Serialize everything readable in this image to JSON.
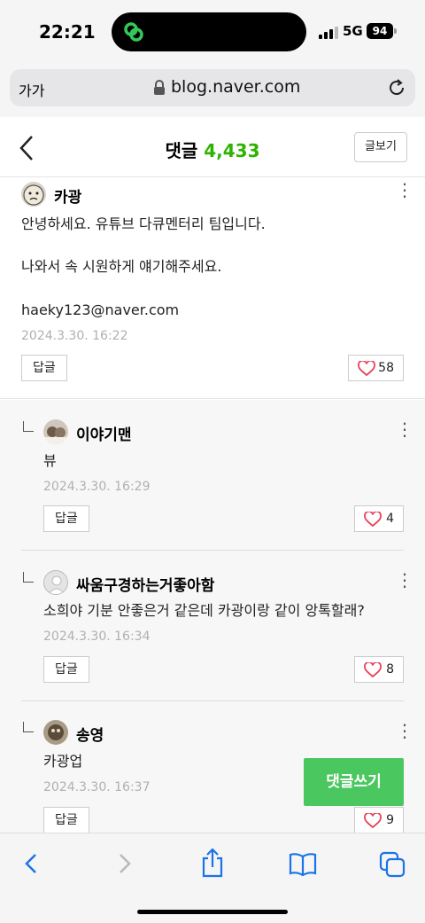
{
  "status_bar": {
    "time": "22:21",
    "network": "5G",
    "battery": "94"
  },
  "browser": {
    "text_size_label": "가가",
    "url": "blog.naver.com"
  },
  "header": {
    "title": "댓글",
    "count": "4,433",
    "view_post_label": "글보기"
  },
  "comments": [
    {
      "author": "카광",
      "lines": [
        "안녕하세요. 유튜브 다큐멘터리 팀입니다.",
        "나와서 속 시원하게 얘기해주세요.",
        "haeky123@naver.com"
      ],
      "date": "2024.3.30. 16:22",
      "reply_label": "답글",
      "likes": "58"
    }
  ],
  "replies": [
    {
      "author": "이야기맨",
      "text": "뷰",
      "date": "2024.3.30. 16:29",
      "reply_label": "답글",
      "likes": "4"
    },
    {
      "author": "싸움구경하는거좋아함",
      "text": "소희야 기분 안좋은거 같은데 카광이랑 같이 앙톡할래?",
      "date": "2024.3.30. 16:34",
      "reply_label": "답글",
      "likes": "8"
    },
    {
      "author": "송영",
      "text": "카광업",
      "date": "2024.3.30. 16:37",
      "reply_label": "답글",
      "likes": "9"
    }
  ],
  "write_comment_label": "댓글쓰기",
  "colors": {
    "accent_green": "#2db400",
    "button_green": "#4bc75f",
    "heart_red": "#e94057"
  },
  "toolbar_icons": [
    "back-icon",
    "forward-icon",
    "share-icon",
    "bookmarks-icon",
    "tabs-icon"
  ]
}
